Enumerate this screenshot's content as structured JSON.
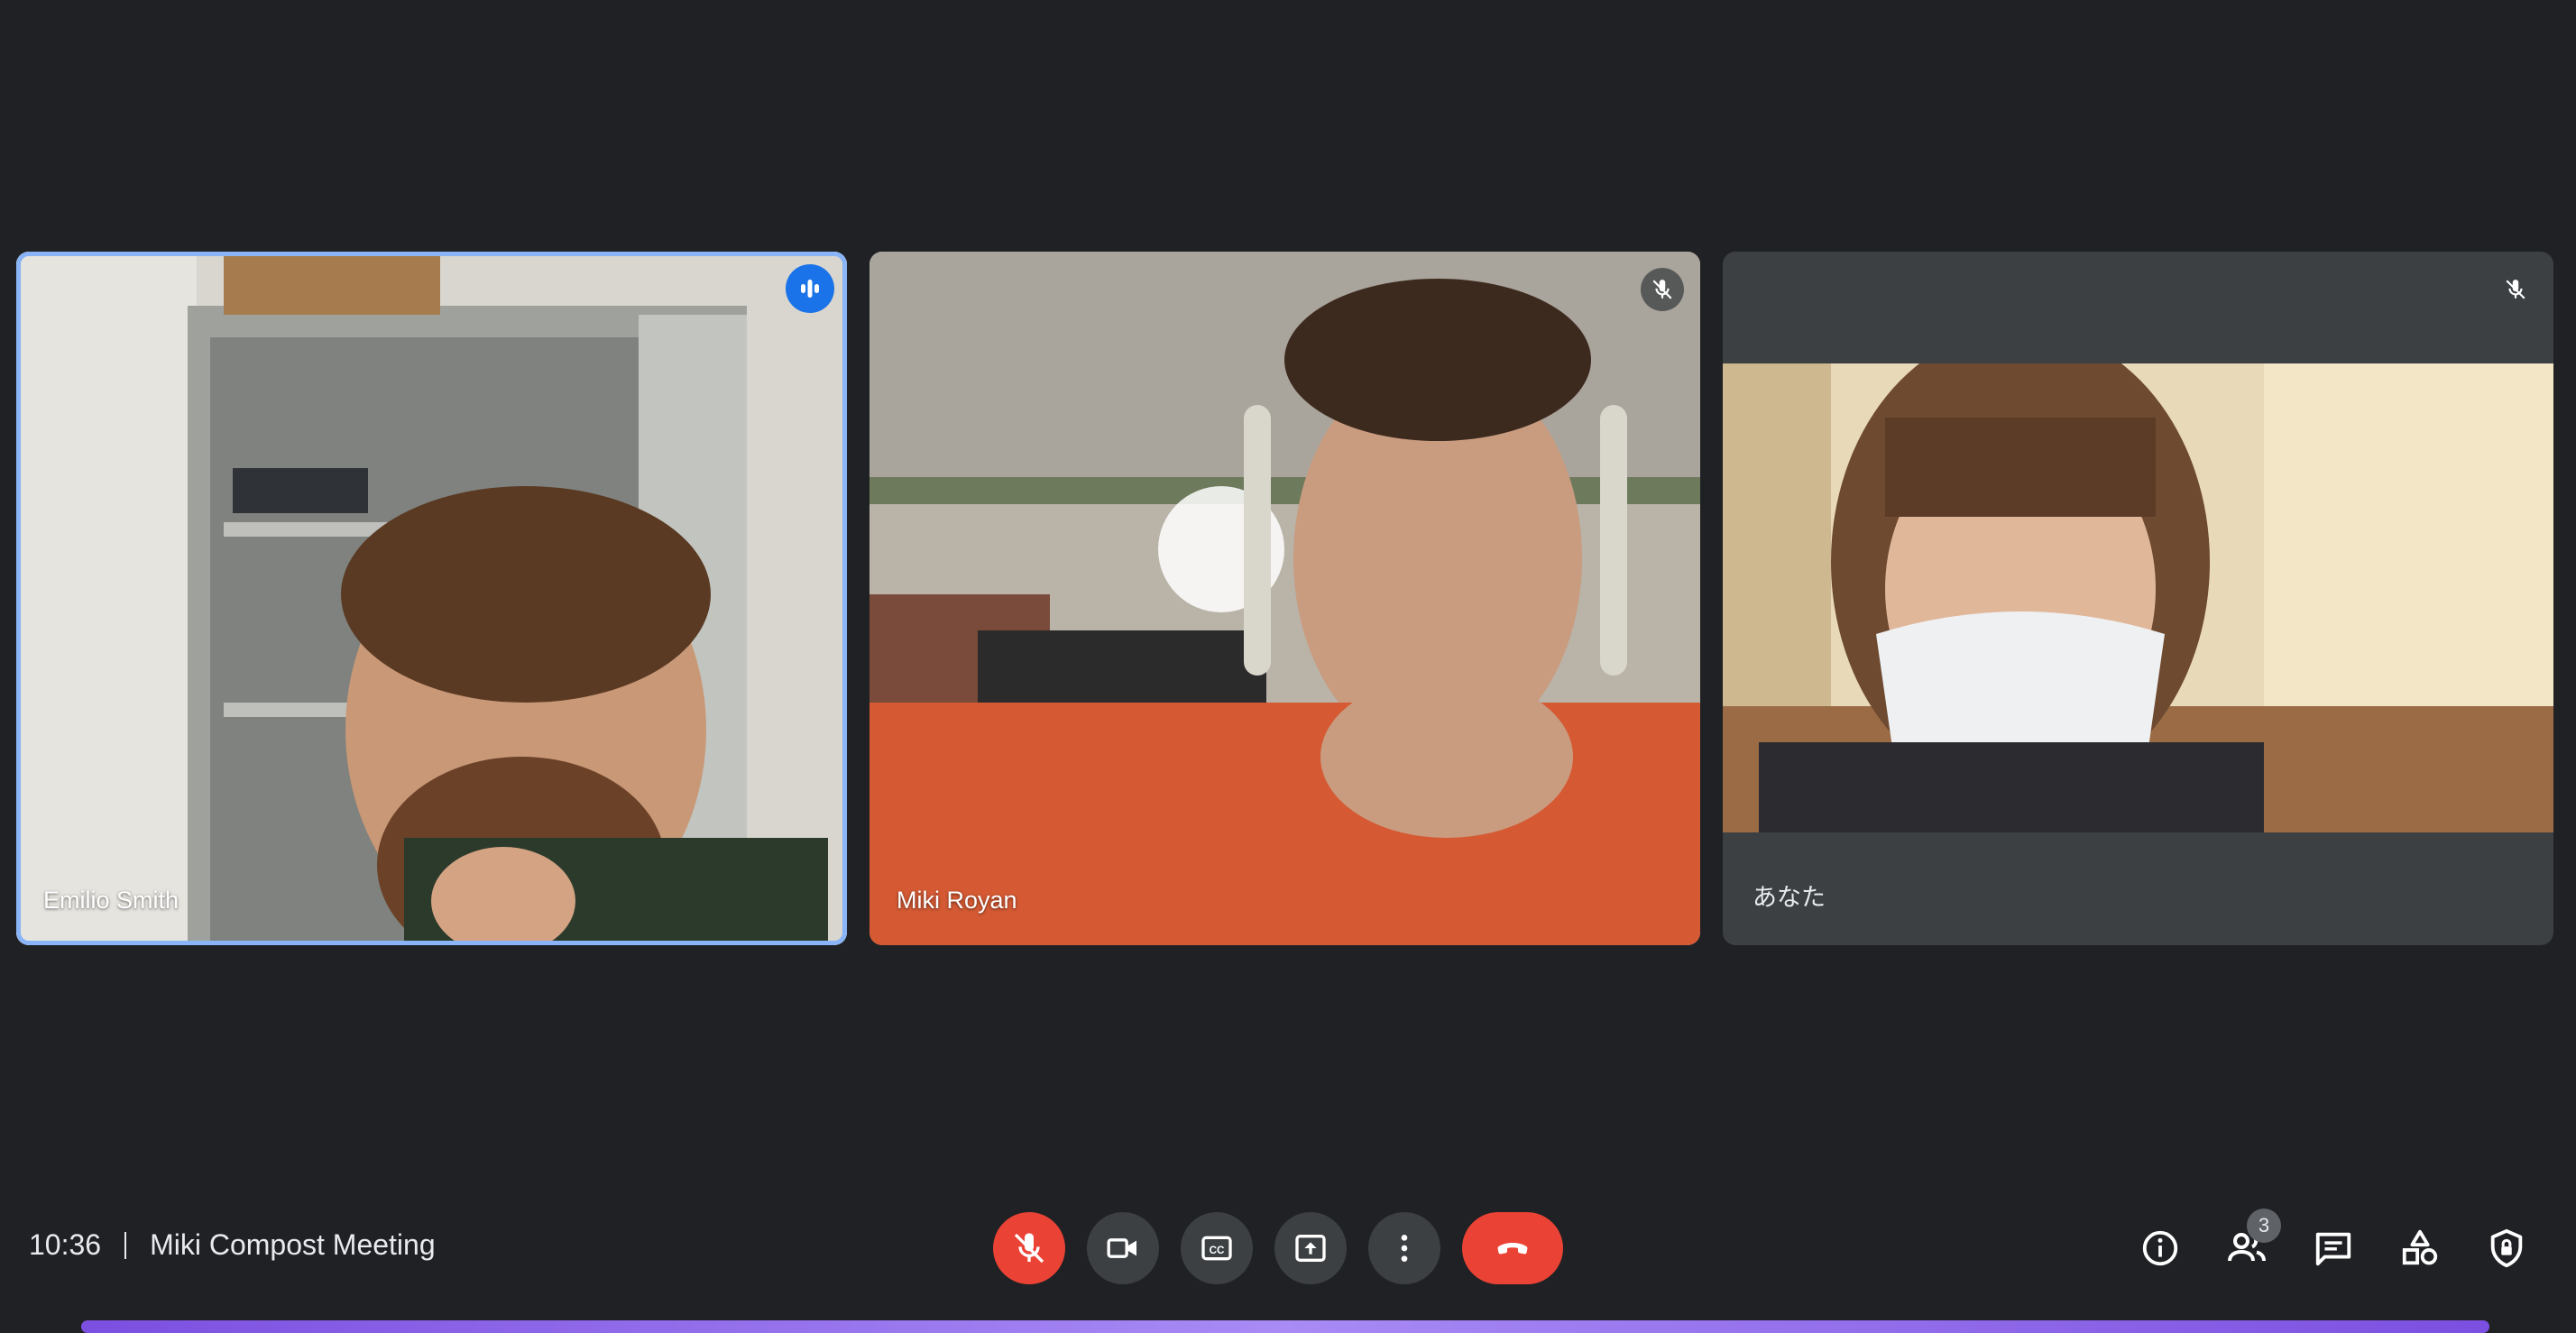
{
  "meeting": {
    "time": "10:36",
    "title": "Miki Compost Meeting"
  },
  "participants": [
    {
      "name": "Emilio Smith",
      "state": "speaking",
      "icon": "speaking-indicator-icon"
    },
    {
      "name": "Miki Royan",
      "state": "muted",
      "icon": "mic-off-icon"
    },
    {
      "name": "あなた",
      "state": "muted",
      "icon": "mic-off-icon"
    }
  ],
  "controls": {
    "mic": {
      "icon": "mic-off-icon",
      "state": "off"
    },
    "camera": {
      "icon": "videocam-icon"
    },
    "captions": {
      "icon": "closed-captions-icon",
      "label": "CC"
    },
    "present": {
      "icon": "present-screen-icon"
    },
    "more": {
      "icon": "more-vert-icon"
    },
    "hangup": {
      "icon": "call-end-icon"
    }
  },
  "side_panel": {
    "info": {
      "icon": "info-icon"
    },
    "people": {
      "icon": "people-icon",
      "count": "3"
    },
    "chat": {
      "icon": "chat-icon"
    },
    "activities": {
      "icon": "activities-icon"
    },
    "host_controls": {
      "icon": "shield-lock-icon"
    }
  },
  "colors": {
    "background": "#202124",
    "tile": "#3c4043",
    "accent": "#8ab4f8",
    "danger": "#ea4335"
  }
}
